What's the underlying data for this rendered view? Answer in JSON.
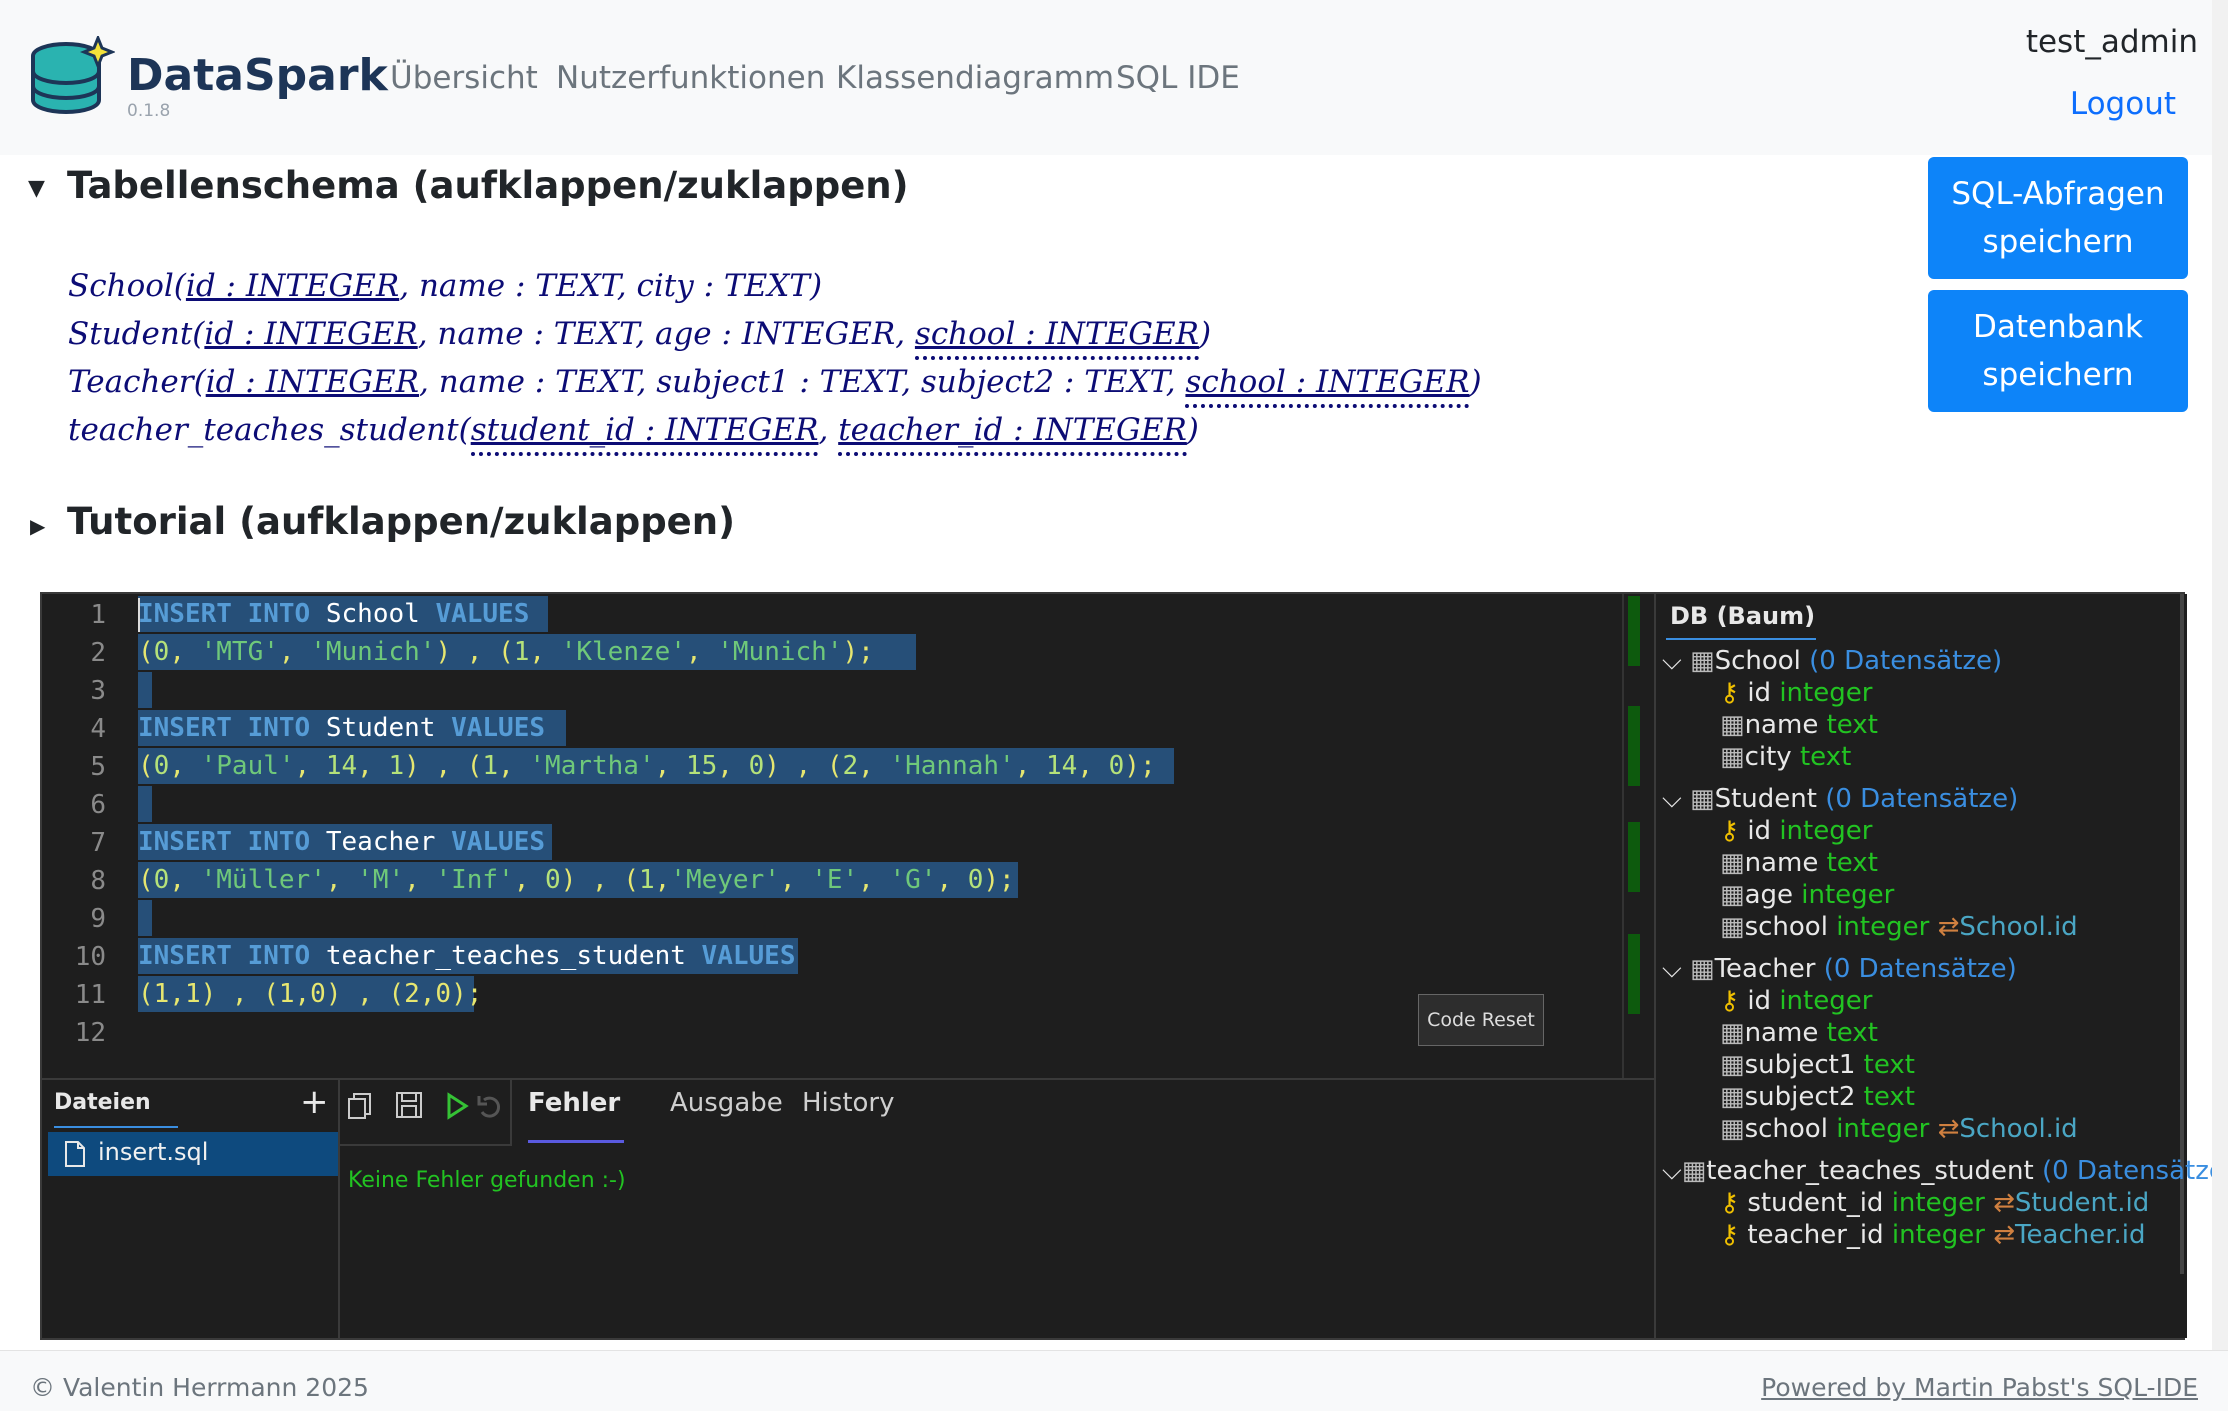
{
  "navbar": {
    "brand": "DataSpark",
    "version": "0.1.8",
    "links": [
      "Übersicht",
      "Nutzerfunktionen",
      "Klassendiagramm",
      "SQL IDE"
    ],
    "user": "test_admin",
    "logout": "Logout"
  },
  "buttons": {
    "save_queries_line1": "SQL-Abfragen",
    "save_queries_line2": "speichern",
    "save_db_line1": "Datenbank",
    "save_db_line2": "speichern"
  },
  "schema": {
    "title": "Tabellenschema (aufklappen/zuklappen)",
    "school": {
      "name": "School(",
      "pk": "id : INTEGER",
      "rest": ", name : TEXT, city : TEXT)"
    },
    "student": {
      "name": "Student(",
      "pk": "id : INTEGER",
      "mid": ", name : TEXT, age : INTEGER, ",
      "fk": "school : INTEGER",
      "end": ")"
    },
    "teacher": {
      "name": "Teacher(",
      "pk": "id : INTEGER",
      "mid": ", name : TEXT, subject1 : TEXT, subject2 : TEXT, ",
      "fk": "school : INTEGER",
      "end": ")"
    },
    "tts": {
      "name": "teacher_teaches_student(",
      "fk1": "student_id : INTEGER",
      "sep": ", ",
      "fk2": "teacher_id : INTEGER",
      "end": ")"
    }
  },
  "tutorial": {
    "title": "Tutorial (aufklappen/zuklappen)"
  },
  "editor": {
    "line_numbers": [
      "1",
      "2",
      "3",
      "4",
      "5",
      "6",
      "7",
      "8",
      "9",
      "10",
      "11",
      "12"
    ],
    "l1": {
      "kw1": "INSERT",
      "kw2": "INTO",
      "table": "School",
      "kw3": "VALUES"
    },
    "l2": {
      "p1": "(",
      "n1": "0",
      "c1": ", ",
      "s1": "'MTG'",
      "c2": ", ",
      "s2": "'Munich'",
      "p2": ") , (",
      "n2": "1",
      "c3": ", ",
      "s3": "'Klenze'",
      "c4": ", ",
      "s4": "'Munich'",
      "p3": ");"
    },
    "l4": {
      "kw1": "INSERT",
      "kw2": "INTO",
      "table": "Student",
      "kw3": "VALUES"
    },
    "l5": {
      "p1": "(",
      "n1": "0",
      "c1": ", ",
      "s1": "'Paul'",
      "c2": ", ",
      "n2": "14",
      "c3": ", ",
      "n3": "1",
      "p2": ") , (",
      "n4": "1",
      "c4": ", ",
      "s2": "'Martha'",
      "c5": ", ",
      "n5": "15",
      "c6": ", ",
      "n6": "0",
      "p3": ") , (",
      "n7": "2",
      "c7": ", ",
      "s3": "'Hannah'",
      "c8": ", ",
      "n8": "14",
      "c9": ", ",
      "n9": "0",
      "p4": ");"
    },
    "l7": {
      "kw1": "INSERT",
      "kw2": "INTO",
      "table": "Teacher",
      "kw3": "VALUES"
    },
    "l8": {
      "p1": "(",
      "n1": "0",
      "c1": ", ",
      "s1": "'Müller'",
      "c2": ", ",
      "s2": "'M'",
      "c3": ", ",
      "s3": "'Inf'",
      "c4": ", ",
      "n2": "0",
      "p2": ") , (",
      "n3": "1",
      "c5": ",",
      "s4": "'Meyer'",
      "c6": ", ",
      "s5": "'E'",
      "c7": ", ",
      "s6": "'G'",
      "c8": ", ",
      "n4": "0",
      "p3": ");"
    },
    "l10": {
      "kw1": "INSERT",
      "kw2": "INTO",
      "table": "teacher_teaches_student",
      "kw3": "VALUES"
    },
    "l11": {
      "text": "(1,1) , (1,0) , (2,0);"
    },
    "code_reset": "Code Reset"
  },
  "files": {
    "title": "Dateien",
    "items": [
      "insert.sql"
    ]
  },
  "tabs": [
    "Fehler",
    "Ausgabe",
    "History"
  ],
  "output": "Keine Fehler gefunden :-)",
  "db_tree": {
    "title": "DB (Baum)",
    "count_label": "(0 Datensätze)",
    "school": {
      "name": "School",
      "cols": [
        [
          "id",
          "integer"
        ],
        [
          "name",
          "text"
        ],
        [
          "city",
          "text"
        ]
      ]
    },
    "student": {
      "name": "Student",
      "cols": [
        [
          "id",
          "integer"
        ],
        [
          "name",
          "text"
        ],
        [
          "age",
          "integer"
        ],
        [
          "school",
          "integer"
        ]
      ],
      "ref": "School.id"
    },
    "teacher": {
      "name": "Teacher",
      "cols": [
        [
          "id",
          "integer"
        ],
        [
          "name",
          "text"
        ],
        [
          "subject1",
          "text"
        ],
        [
          "subject2",
          "text"
        ],
        [
          "school",
          "integer"
        ]
      ],
      "ref": "School.id"
    },
    "tts": {
      "name": "teacher_teaches_student",
      "cols": [
        [
          "student_id",
          "integer"
        ],
        [
          "teacher_id",
          "integer"
        ]
      ],
      "refs": [
        "Student.id",
        "Teacher.id"
      ]
    }
  },
  "footer": {
    "copyright": "© Valentin Herrmann 2025",
    "powered": "Powered by Martin Pabst's SQL-IDE"
  },
  "colors": {
    "accent": "#0d84f9",
    "brand": "#1d3557",
    "keyword": "#569cd6",
    "string": "#6fc87a",
    "selection": "#264f78"
  }
}
